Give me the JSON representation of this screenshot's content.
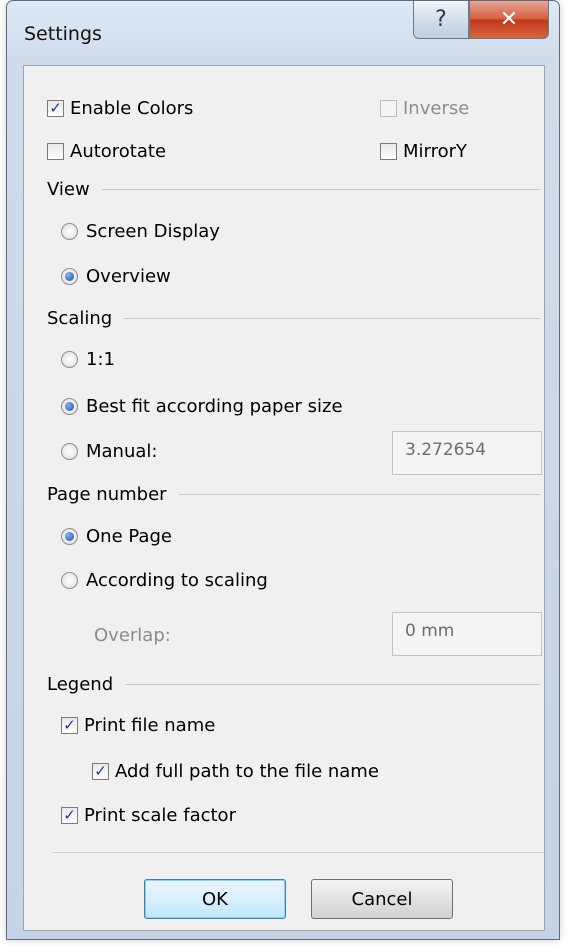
{
  "window": {
    "title": "Settings",
    "help_glyph": "?",
    "close_glyph": "✕"
  },
  "options": {
    "enable_colors": {
      "label": "Enable Colors",
      "checked": true
    },
    "inverse": {
      "label": "Inverse",
      "checked": false,
      "disabled": true
    },
    "autorotate": {
      "label": "Autorotate",
      "checked": false
    },
    "mirror_y": {
      "label": "MirrorY",
      "checked": false
    }
  },
  "view": {
    "heading": "View",
    "screen_display": "Screen Display",
    "overview": "Overview",
    "selected": "Overview"
  },
  "scaling": {
    "heading": "Scaling",
    "one_to_one": "1:1",
    "best_fit": "Best fit according paper size",
    "manual": "Manual:",
    "manual_value": "3.272654",
    "selected": "Best fit according paper size"
  },
  "page_number": {
    "heading": "Page number",
    "one_page": "One Page",
    "according_to_scaling": "According to scaling",
    "overlap_label": "Overlap:",
    "overlap_value": "0 mm",
    "selected": "One Page"
  },
  "legend": {
    "heading": "Legend",
    "print_file_name": {
      "label": "Print file name",
      "checked": true
    },
    "add_full_path": {
      "label": "Add full path to the file name",
      "checked": true
    },
    "print_scale_factor": {
      "label": "Print scale factor",
      "checked": true
    }
  },
  "buttons": {
    "ok": "OK",
    "cancel": "Cancel"
  },
  "icons": {
    "check": "✓"
  }
}
